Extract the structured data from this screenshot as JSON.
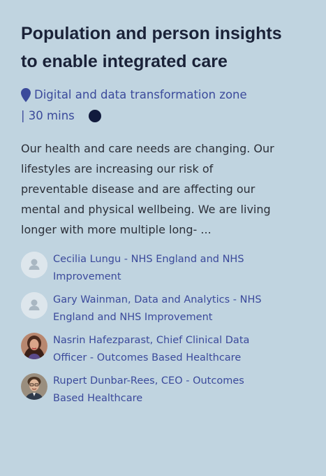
{
  "session": {
    "title": "Population and person insights to enable integrated care",
    "location": "Digital and data transformation zone",
    "duration": "| 30 mins",
    "description": "Our health and care needs are changing. Our lifestyles are increasing our risk of preventable disease and are affecting our mental and physical wellbeing. We are living longer with more multiple long- ..."
  },
  "icons": {
    "location": "map-pin-icon",
    "status": "status-dot-icon",
    "placeholder_avatar": "person-placeholder-icon"
  },
  "colors": {
    "background": "#c0d4e0",
    "title": "#1a2238",
    "link": "#3b4a9b",
    "dot": "#111a3d"
  },
  "speakers": [
    {
      "name": "Cecilia Lungu - NHS England and NHS Improvement",
      "avatar": "placeholder"
    },
    {
      "name": "Gary Wainman, Data and Analytics - NHS England and NHS Improvement",
      "avatar": "placeholder"
    },
    {
      "name": "Nasrin Hafezparast, Chief Clinical Data Officer - Outcomes Based Healthcare",
      "avatar": "photo"
    },
    {
      "name": "Rupert Dunbar-Rees, CEO - Outcomes Based Healthcare",
      "avatar": "photo"
    }
  ]
}
